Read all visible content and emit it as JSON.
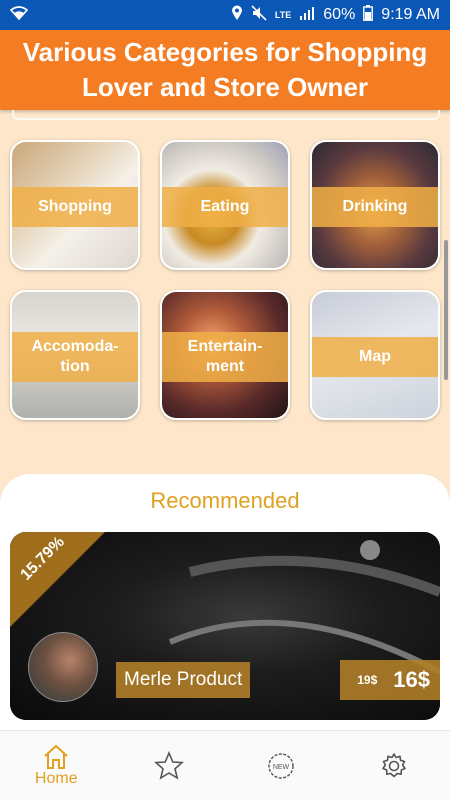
{
  "status_bar": {
    "lte": "LTE",
    "battery": "60%",
    "time": "9:19 AM"
  },
  "header": {
    "title_line1": "Various Categories for Shopping",
    "title_line2": "Lover and Store Owner"
  },
  "categories": [
    {
      "label": "Shopping",
      "icon": "shopping-photo"
    },
    {
      "label": "Eating",
      "icon": "eating-photo"
    },
    {
      "label": "Drinking",
      "icon": "drinking-photo"
    },
    {
      "label_line1": "Accomoda-",
      "label_line2": "tion",
      "icon": "accommodation-photo"
    },
    {
      "label_line1": "Entertain-",
      "label_line2": "ment",
      "icon": "entertainment-photo"
    },
    {
      "label": "Map",
      "icon": "map-photo"
    }
  ],
  "recommended": {
    "title": "Recommended",
    "product": {
      "discount": "15.79%",
      "name": "Merle Product",
      "old_price": "19$",
      "price": "16$"
    }
  },
  "bottom_nav": [
    {
      "label": "Home",
      "icon": "home-icon",
      "active": true
    },
    {
      "label": "",
      "icon": "star-icon",
      "active": false
    },
    {
      "label": "",
      "icon": "new-badge-icon",
      "active": false
    },
    {
      "label": "",
      "icon": "gear-icon",
      "active": false
    }
  ],
  "colors": {
    "status_bar": "#0b57b5",
    "header": "#f47d23",
    "background": "#fde6c9",
    "accent": "#e0a020",
    "label_band": "#f0af46"
  }
}
